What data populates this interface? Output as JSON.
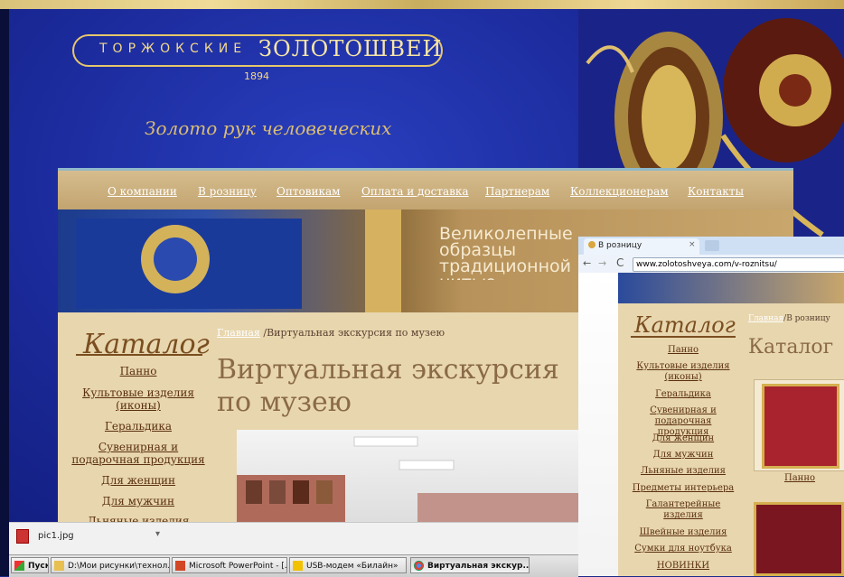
{
  "logo": {
    "line1": "ТОРЖОКСКИЕ",
    "line2": "ЗОЛОТОШВЕИ",
    "year": "1894"
  },
  "tagline": "Золото рук человеческих",
  "menu": [
    "О компании",
    "В розницу",
    "Оптовикам",
    "Оплата и доставка",
    "Партнерам",
    "Коллекционерам",
    "Контакты"
  ],
  "banner_text": "Великолепные образцы традиционной нитью",
  "catalog": {
    "title": "Каталог",
    "items": [
      "Панно",
      "Культовые изделия (иконы)",
      "Геральдика",
      "Сувенирная и подарочная продукция",
      "Для женщин",
      "Для мужчин",
      "Льняные изделия"
    ]
  },
  "breadcrumb": {
    "home": "Главная",
    "current": "/Виртуальная экскурсия по музею"
  },
  "page_title": "Виртуальная экскурсия по музею",
  "window2": {
    "tab": "В розницу",
    "url": "www.zolotoshveya.com/v-roznitsu/",
    "breadcrumb_home": "Главная",
    "breadcrumb_current": "/В розницу",
    "catalog_title": "Каталог",
    "heading": "Каталог",
    "items": [
      "Панно",
      "Культовые изделия (иконы)",
      "Геральдика",
      "Сувенирная и подарочная продукция",
      "Для женщин",
      "Для мужчин",
      "Льняные изделия",
      "Предметы интерьера",
      "Галантерейные изделия",
      "Швейные изделия",
      "Сумки для ноутбука",
      "НОВИНКИ"
    ],
    "product_caption": "Панно"
  },
  "download": {
    "file": "pic1.jpg"
  },
  "taskbar": {
    "start": "Пуск",
    "buttons": [
      "D:\\Мои рисунки\\технол...",
      "Microsoft PowerPoint - [...",
      "USB-модем «Билайн»",
      "Виртуальная экскур..."
    ]
  }
}
